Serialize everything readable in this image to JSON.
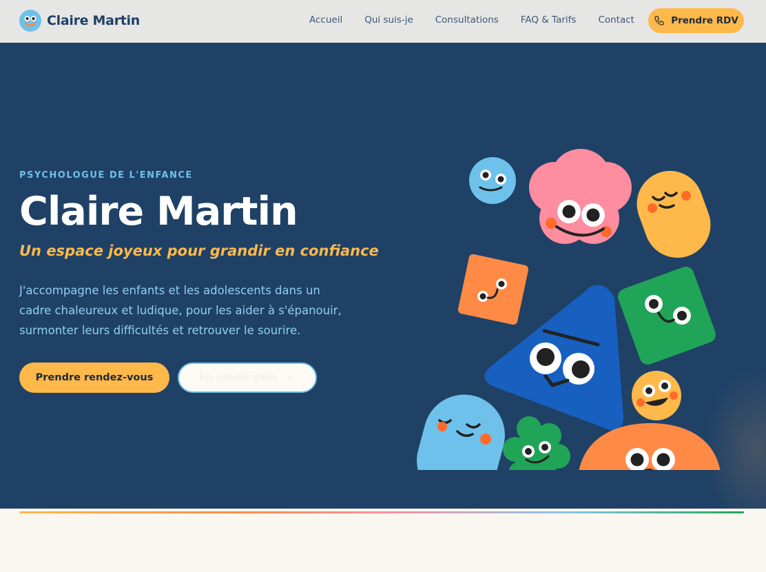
{
  "brand": {
    "name": "Claire Martin",
    "logo_icon": "smiling-face-icon"
  },
  "nav": {
    "links": [
      "Accueil",
      "Qui suis-je",
      "Consultations",
      "FAQ & Tarifs",
      "Contact"
    ],
    "cta_label": "Prendre RDV",
    "cta_icon": "phone-icon"
  },
  "hero": {
    "eyebrow": "PSYCHOLOGUE DE L'ENFANCE",
    "title": "Claire Martin",
    "subtitle": "Un espace joyeux pour grandir en confiance",
    "description": "J'accompagne les enfants et les adolescents dans un cadre chaleureux et ludique, pour les aider à s'épanouir, surmonter leurs difficultés et retrouver le sourire.",
    "primary_cta": "Prendre rendez-vous",
    "secondary_cta": "En savoir plus",
    "secondary_cta_icon": "chevron-down-icon",
    "illustration": "smiling-shapes-illustration"
  },
  "colors": {
    "navy": "#1f4166",
    "accent_yellow": "#ffb94a",
    "light_blue": "#6ec1ea",
    "pink": "#ff8da0",
    "green": "#20a457",
    "orange": "#ff8a45",
    "blue": "#1760c0"
  }
}
